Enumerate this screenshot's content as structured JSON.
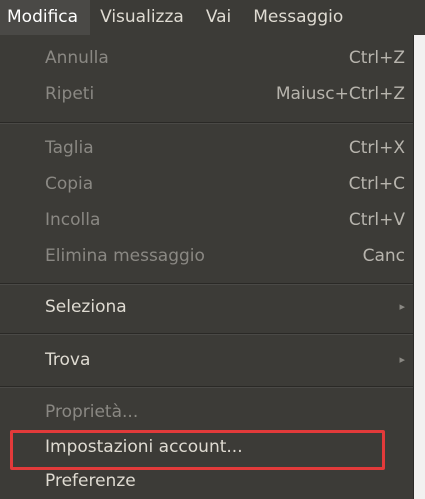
{
  "menubar": {
    "items": [
      {
        "label": "Modifica",
        "open": true
      },
      {
        "label": "Visualizza"
      },
      {
        "label": "Vai"
      },
      {
        "label": "Messaggio"
      }
    ]
  },
  "menu": {
    "annulla": {
      "label": "Annulla",
      "accel": "Ctrl+Z"
    },
    "ripeti": {
      "label": "Ripeti",
      "accel": "Maiusc+Ctrl+Z"
    },
    "taglia": {
      "label": "Taglia",
      "accel": "Ctrl+X"
    },
    "copia": {
      "label": "Copia",
      "accel": "Ctrl+C"
    },
    "incolla": {
      "label": "Incolla",
      "accel": "Ctrl+V"
    },
    "elimina": {
      "label": "Elimina messaggio",
      "accel": "Canc"
    },
    "seleziona": {
      "label": "Seleziona",
      "submenu_arrow": "▸"
    },
    "trova": {
      "label": "Trova",
      "submenu_arrow": "▸"
    },
    "proprieta": {
      "label": "Proprietà..."
    },
    "impostazioni": {
      "label": "Impostazioni account..."
    },
    "preferenze": {
      "label": "Preferenze"
    }
  },
  "colors": {
    "menu_bg": "#3c3b37",
    "menu_text": "#dfdbd2",
    "highlight_border": "#e23a3a"
  }
}
